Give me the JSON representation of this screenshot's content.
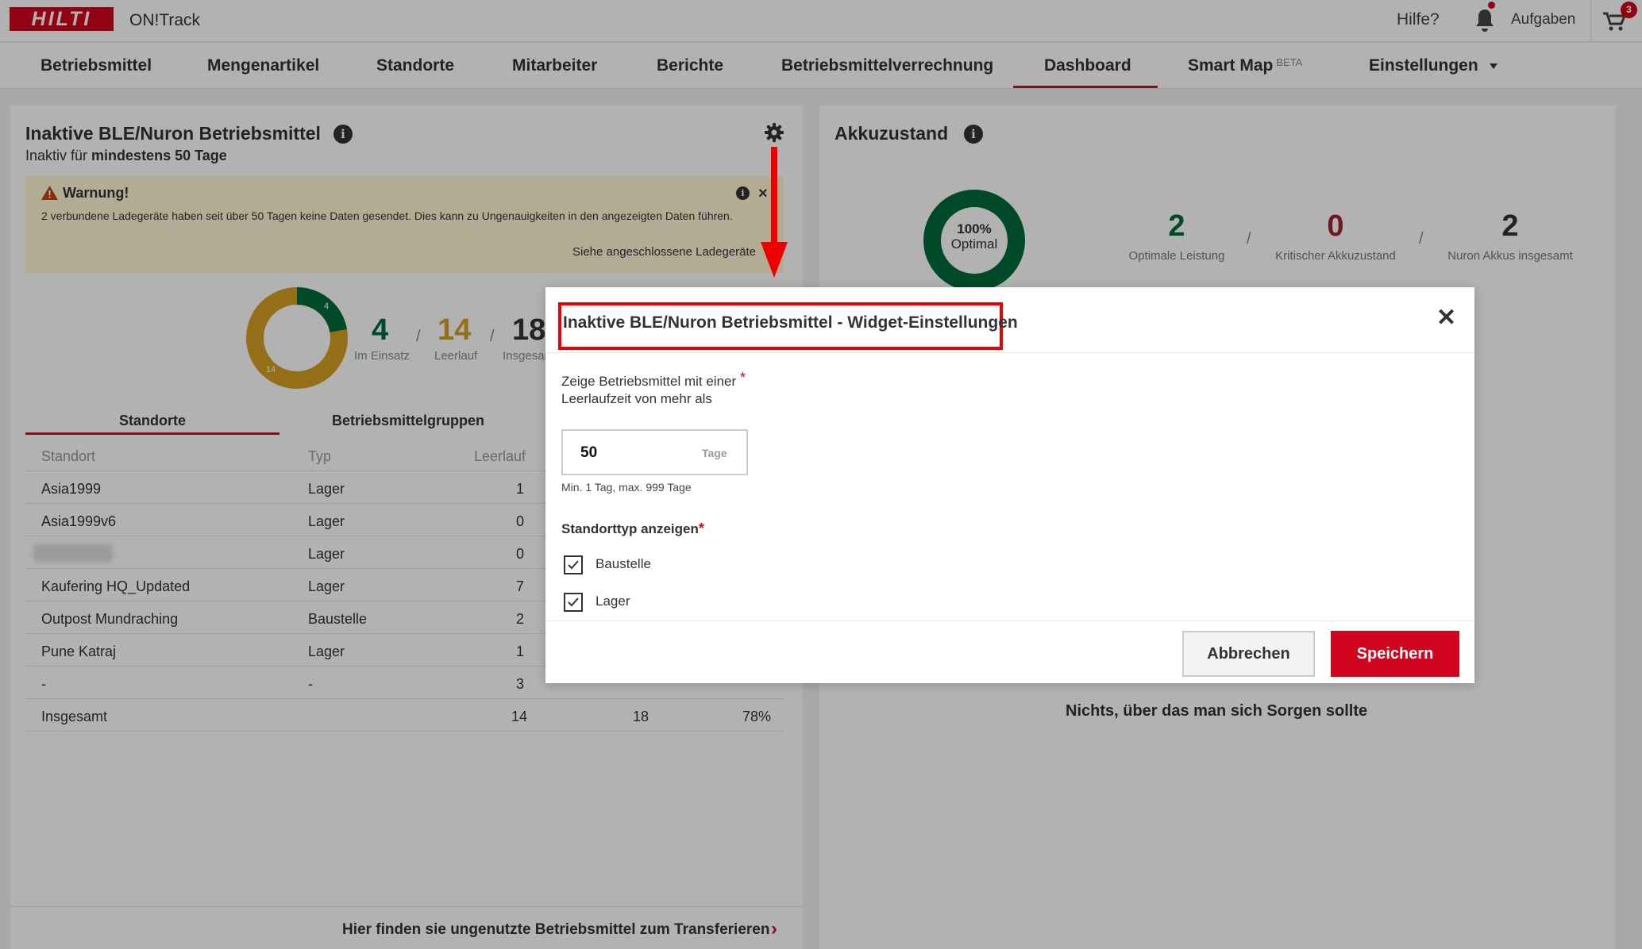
{
  "header": {
    "logo": "HILTI",
    "app_name": "ON!Track",
    "help": "Hilfe?",
    "tasks": "Aufgaben",
    "cart_badge": "3"
  },
  "nav": {
    "items": [
      "Betriebsmittel",
      "Mengenartikel",
      "Standorte",
      "Mitarbeiter",
      "Berichte",
      "Betriebsmittelverrechnung",
      "Dashboard",
      "Smart Map",
      "Einstellungen"
    ],
    "smart_map_badge": "BETA",
    "active": "Dashboard"
  },
  "left_widget": {
    "title": "Inaktive BLE/Nuron Betriebsmittel",
    "subtitle_prefix": "Inaktiv für",
    "subtitle_bold": "mindestens 50 Tage",
    "warning": {
      "title": "Warnung!",
      "text": "2 verbundene Ladegeräte haben seit über 50 Tagen keine Daten gesendet. Dies kann zu Ungenauigkeiten in den angezeigten Daten führen.",
      "link": "Siehe angeschlossene Ladegeräte"
    },
    "donut": {
      "in_use": 4,
      "idle": 14,
      "label_in_use": "4",
      "label_idle": "14"
    },
    "stats": [
      {
        "value": "4",
        "label": "Im Einsatz",
        "color": "#006b3c"
      },
      {
        "value": "14",
        "label": "Leerlauf",
        "color": "#d4a021"
      },
      {
        "value": "18",
        "label": "Insgesamt",
        "color": "#333333"
      }
    ],
    "tabs": [
      "Standorte",
      "Betriebsmittelgruppen"
    ],
    "table": {
      "headers": [
        "Standort",
        "Typ",
        "Leerlauf"
      ],
      "rows": [
        [
          "Asia1999",
          "Lager",
          "1"
        ],
        [
          "Asia1999v6",
          "Lager",
          "0"
        ],
        [
          "",
          "Lager",
          "0"
        ],
        [
          "Kaufering HQ_Updated",
          "Lager",
          "7"
        ],
        [
          "Outpost Mundraching",
          "Baustelle",
          "2"
        ],
        [
          "Pune Katraj",
          "Lager",
          "1"
        ],
        [
          "-",
          "-",
          "3"
        ]
      ],
      "total": {
        "label": "Insgesamt",
        "idle": "14",
        "total": "18",
        "percent": "78%"
      }
    },
    "bottom_link": "Hier finden sie ungenutzte Betriebsmittel zum Transferieren"
  },
  "right_widget": {
    "title": "Akkuzustand",
    "ring_percent": "100%",
    "ring_label": "Optimal",
    "stats": [
      {
        "value": "2",
        "label": "Optimale Leistung",
        "color": "#006b3c"
      },
      {
        "value": "0",
        "label": "Kritischer Akkuzustand",
        "color": "#a3242e"
      },
      {
        "value": "2",
        "label": "Nuron Akkus insgesamt",
        "color": "#333333"
      }
    ],
    "empty_message": "Nichts, über das man sich Sorgen sollte"
  },
  "modal": {
    "title": "Inaktive BLE/Nuron Betriebsmittel - Widget-Einstellungen",
    "field_label": "Zeige Betriebsmittel mit einer Leerlaufzeit von mehr als",
    "field_value": "50",
    "field_unit": "Tage",
    "field_hint": "Min. 1 Tag, max. 999 Tage",
    "location_type_label": "Standorttyp anzeigen",
    "options": [
      {
        "label": "Baustelle",
        "checked": true
      },
      {
        "label": "Lager",
        "checked": true
      }
    ],
    "cancel": "Abbrechen",
    "save": "Speichern"
  },
  "colors": {
    "brand_red": "#d2051e",
    "green": "#006b3c",
    "amber": "#d4a021",
    "annotation_red": "#ee0000"
  }
}
